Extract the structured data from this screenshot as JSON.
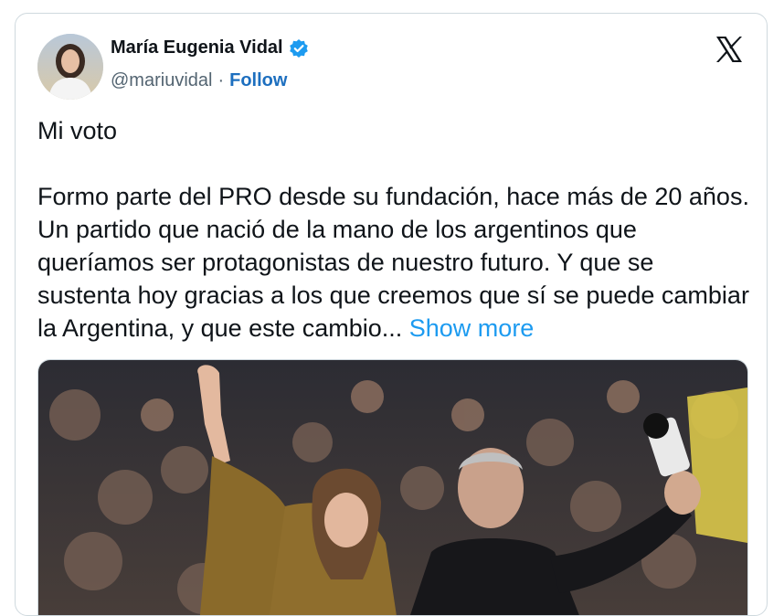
{
  "tweet": {
    "author_name": "María Eugenia Vidal",
    "handle": "@mariuvidal",
    "separator": "·",
    "follow_label": "Follow",
    "title_line": "Mi voto",
    "body_text": "Formo parte del PRO desde su fundación, hace más de 20 años. Un partido que nació de la mano de los argentinos que queríamos ser protagonistas de nuestro futuro. Y que se sustenta hoy gracias a los que creemos que sí se puede cambiar la Argentina, y que este cambio...",
    "show_more_label": "Show more",
    "verified_icon": "verified-badge-icon",
    "platform_icon": "x-logo-icon"
  },
  "colors": {
    "accent": "#1d9bf0",
    "follow": "#1d6fbf",
    "text": "#0f1419",
    "muted": "#536471",
    "border": "#cfd9de"
  }
}
